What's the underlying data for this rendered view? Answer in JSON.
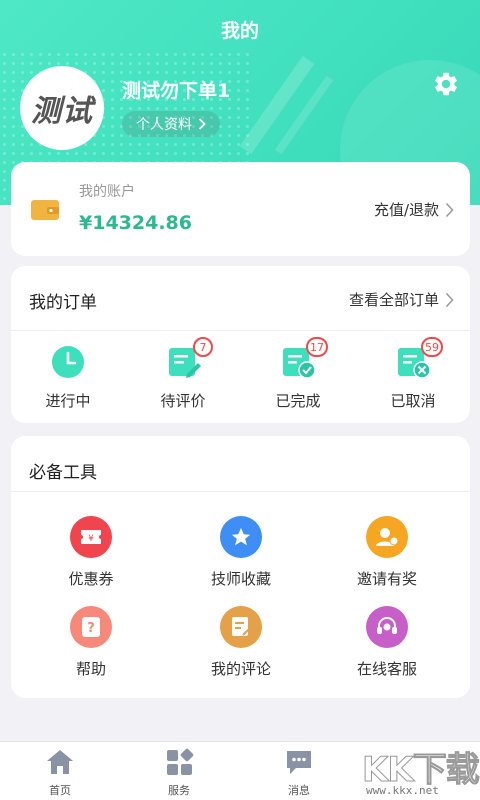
{
  "header": {
    "title": "我的",
    "username": "测试勿下单1",
    "avatar_text": "测试",
    "profile_label": "个人资料"
  },
  "account": {
    "label": "我的账户",
    "balance": "¥14324.86",
    "action": "充值/退款"
  },
  "orders": {
    "title": "我的订单",
    "view_all": "查看全部订单",
    "items": [
      {
        "label": "进行中",
        "badge": ""
      },
      {
        "label": "待评价",
        "badge": "7"
      },
      {
        "label": "已完成",
        "badge": "17"
      },
      {
        "label": "已取消",
        "badge": "59"
      }
    ]
  },
  "tools": {
    "title": "必备工具",
    "items": [
      {
        "label": "优惠券",
        "color": "#f0444f"
      },
      {
        "label": "技师收藏",
        "color": "#3f8ef5"
      },
      {
        "label": "邀请有奖",
        "color": "#f5a623"
      },
      {
        "label": "帮助",
        "color": "#f7897a"
      },
      {
        "label": "我的评论",
        "color": "#e5a04a"
      },
      {
        "label": "在线客服",
        "color": "#c660c8"
      }
    ]
  },
  "tabbar": {
    "items": [
      {
        "label": "首页"
      },
      {
        "label": "服务"
      },
      {
        "label": "消息"
      }
    ]
  },
  "watermark": {
    "brand": "KK下载",
    "url": "www.kkx.net"
  },
  "colors": {
    "accent": "#3ddfbd",
    "price": "#2bb98f",
    "badge": "#ef4a4a"
  }
}
